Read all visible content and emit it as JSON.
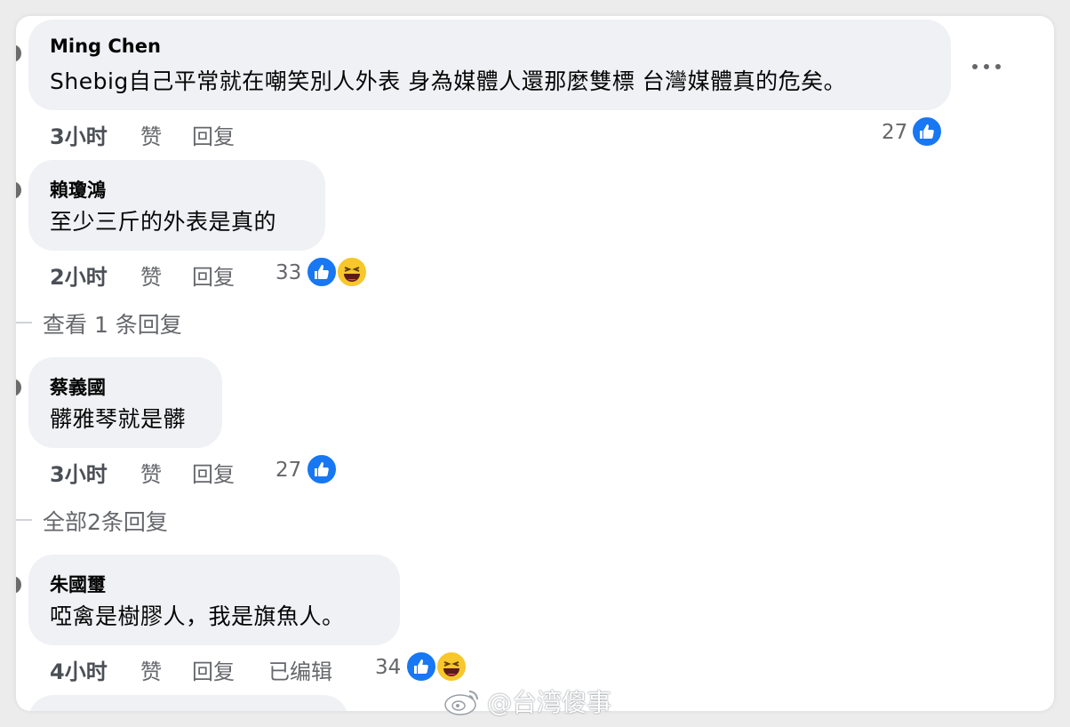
{
  "comments": [
    {
      "author": "Ming Chen",
      "text": "Shebig自己平常就在嘲笑別人外表 身為媒體人還那麼雙標 台灣媒體真的危矣。",
      "time": "3小时",
      "like_label": "赞",
      "reply_label": "回复",
      "reaction_count": "27",
      "reactions": [
        "like-icon"
      ]
    },
    {
      "author": "賴瓊鴻",
      "text": "至少三斤的外表是真的",
      "time": "2小时",
      "like_label": "赞",
      "reply_label": "回复",
      "reaction_count": "33",
      "reactions": [
        "like-icon",
        "haha-icon"
      ],
      "replies_link": "查看 1 条回复"
    },
    {
      "author": "蔡義國",
      "text": "髒雅琴就是髒",
      "time": "3小时",
      "like_label": "赞",
      "reply_label": "回复",
      "reaction_count": "27",
      "reactions": [
        "like-icon"
      ],
      "replies_link": "全部2条回复"
    },
    {
      "author": "朱國璽",
      "text": "啞禽是樹膠人，我是旗魚人。",
      "time": "4小时",
      "like_label": "赞",
      "reply_label": "回复",
      "edited_label": "已编辑",
      "reaction_count": "34",
      "reactions": [
        "like-icon",
        "haha-icon"
      ]
    }
  ],
  "watermark": {
    "text": "@台湾傻事",
    "icon": "weibo-logo-icon"
  },
  "colors": {
    "bubble": "#eff1f4",
    "like_blue": "#1877f2",
    "meta_gray": "#65676b",
    "haha_yellow": "#f7c72b"
  }
}
